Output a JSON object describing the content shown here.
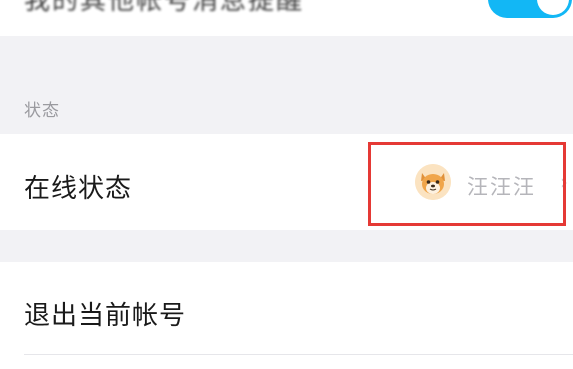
{
  "top_row": {
    "label": "我的其他帐号消息提醒",
    "toggle_on": true
  },
  "section": {
    "title": "状态"
  },
  "online_status": {
    "label": "在线状态",
    "value": "汪汪汪",
    "avatar_icon": "dog-avatar-icon",
    "chevron": "›"
  },
  "logout": {
    "label": "退出当前帐号"
  },
  "colors": {
    "toggle_accent": "#12b7f5",
    "highlight": "#e53935"
  }
}
